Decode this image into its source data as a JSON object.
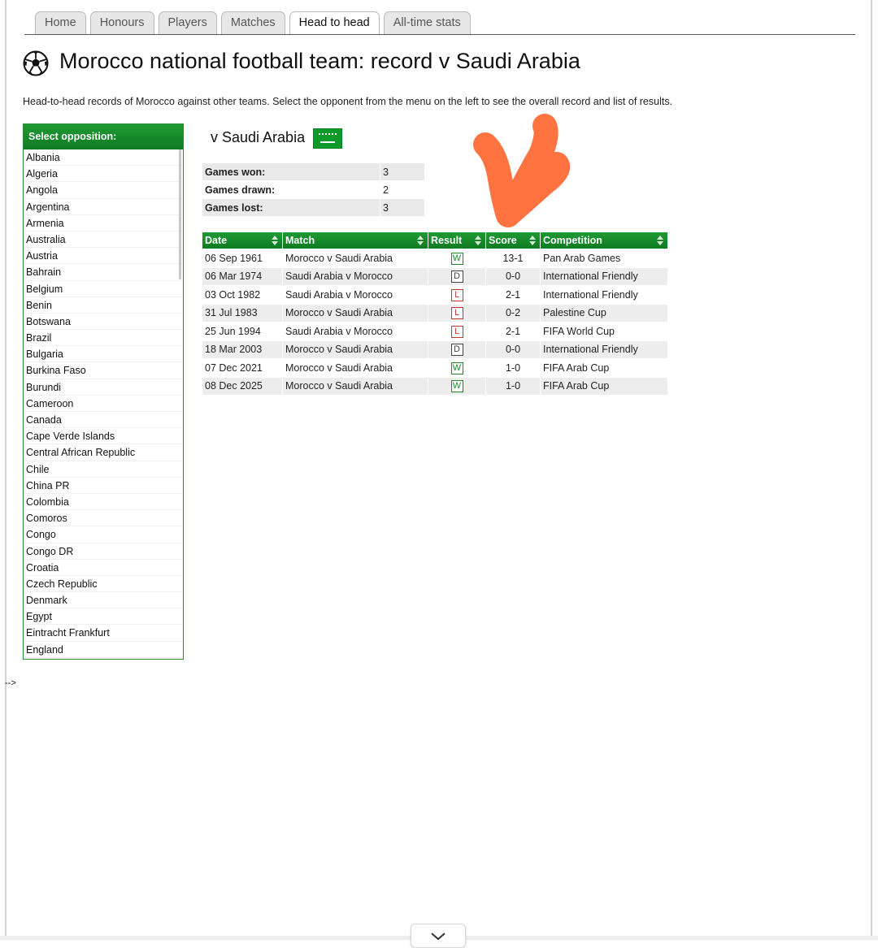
{
  "tabs": [
    {
      "label": "Home",
      "active": false
    },
    {
      "label": "Honours",
      "active": false
    },
    {
      "label": "Players",
      "active": false
    },
    {
      "label": "Matches",
      "active": false
    },
    {
      "label": "Head to head",
      "active": true
    },
    {
      "label": "All-time stats",
      "active": false
    }
  ],
  "page": {
    "icon": "football-icon",
    "title": "Morocco national football team: record v Saudi Arabia",
    "intro": "Head-to-head records of Morocco against other teams. Select the opponent from the menu on the left to see the overall record and list of results."
  },
  "sidebar": {
    "header": "Select opposition:",
    "items": [
      "Albania",
      "Algeria",
      "Angola",
      "Argentina",
      "Armenia",
      "Australia",
      "Austria",
      "Bahrain",
      "Belgium",
      "Benin",
      "Botswana",
      "Brazil",
      "Bulgaria",
      "Burkina Faso",
      "Burundi",
      "Cameroon",
      "Canada",
      "Cape Verde Islands",
      "Central African Republic",
      "Chile",
      "China PR",
      "Colombia",
      "Comoros",
      "Congo",
      "Congo DR",
      "Croatia",
      "Czech Republic",
      "Denmark",
      "Egypt",
      "Eintracht Frankfurt",
      "England"
    ]
  },
  "opponent": {
    "title": "v Saudi Arabia",
    "flag_icon": "saudi-arabia-flag-icon"
  },
  "summary": [
    {
      "label": "Games won:",
      "value": "3"
    },
    {
      "label": "Games drawn:",
      "value": "2"
    },
    {
      "label": "Games lost:",
      "value": "3"
    }
  ],
  "results": {
    "headers": [
      "Date",
      "Match",
      "Result",
      "Score",
      "Competition"
    ],
    "rows": [
      {
        "date": "06 Sep 1961",
        "match": "Morocco v Saudi Arabia",
        "result": "W",
        "score": "13-1",
        "competition": "Pan Arab Games"
      },
      {
        "date": "06 Mar 1974",
        "match": "Saudi Arabia v Morocco",
        "result": "D",
        "score": "0-0",
        "competition": "International Friendly"
      },
      {
        "date": "03 Oct 1982",
        "match": "Saudi Arabia v Morocco",
        "result": "L",
        "score": "2-1",
        "competition": "International Friendly"
      },
      {
        "date": "31 Jul 1983",
        "match": "Morocco v Saudi Arabia",
        "result": "L",
        "score": "0-2",
        "competition": "Palestine Cup"
      },
      {
        "date": "25 Jun 1994",
        "match": "Saudi Arabia v Morocco",
        "result": "L",
        "score": "2-1",
        "competition": "FIFA World Cup"
      },
      {
        "date": "18 Mar 2003",
        "match": "Morocco v Saudi Arabia",
        "result": "D",
        "score": "0-0",
        "competition": "International Friendly"
      },
      {
        "date": "07 Dec 2021",
        "match": "Morocco v Saudi Arabia",
        "result": "W",
        "score": "1-0",
        "competition": "FIFA Arab Cup"
      },
      {
        "date": "08 Dec 2025",
        "match": "Morocco v Saudi Arabia",
        "result": "W",
        "score": "1-0",
        "competition": "FIFA Arab Cup"
      }
    ]
  },
  "stray_text": "-->",
  "colors": {
    "accent_green": "#0f7a22",
    "win": "#1a8a2a",
    "loss": "#c0392b",
    "annotation": "#ff7340"
  },
  "annotation": {
    "icon": "hand-drawn-checkmark-icon"
  },
  "scroll_button": {
    "icon": "chevron-down-icon"
  }
}
